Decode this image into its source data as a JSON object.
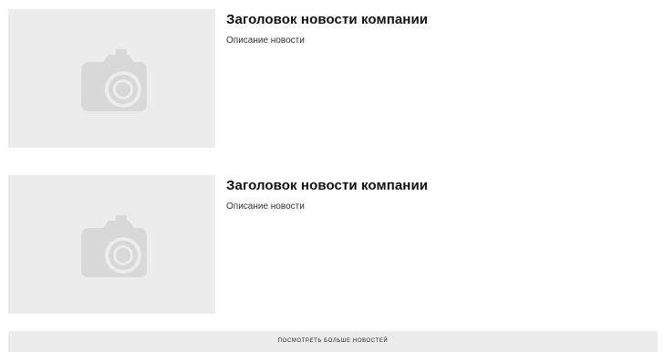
{
  "news": [
    {
      "title": "Заголовок новости компании",
      "description": "Описание новости",
      "image_icon": "camera-icon"
    },
    {
      "title": "Заголовок новости компании",
      "description": "Описание новости",
      "image_icon": "camera-icon"
    }
  ],
  "more_button": {
    "label": "посмотреть больше новостей"
  },
  "colors": {
    "placeholder_bg": "#ececec",
    "icon": "#d6d6d6",
    "button_bg": "#ececec"
  }
}
